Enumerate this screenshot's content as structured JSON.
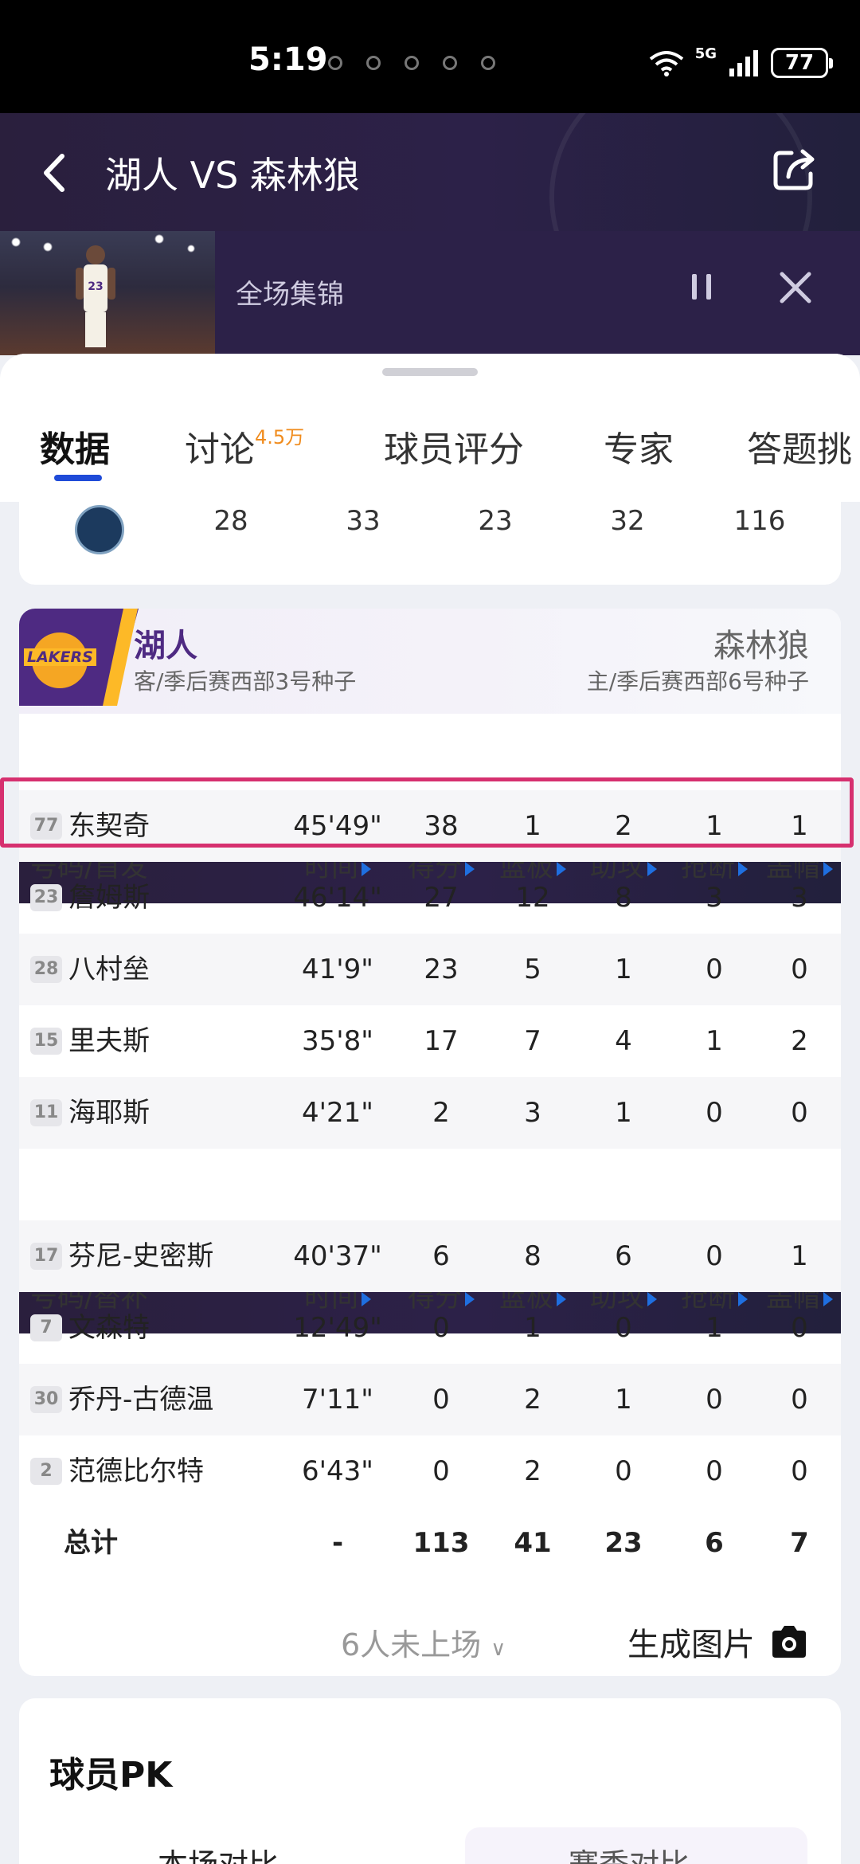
{
  "status_bar": {
    "time": "5:19",
    "network": "5G",
    "battery": "77"
  },
  "header": {
    "title": "湖人 VS 森林狼"
  },
  "video": {
    "title": "全场集锦"
  },
  "tabs": [
    {
      "label": "数据",
      "badge": ""
    },
    {
      "label": "讨论",
      "badge": "4.5万"
    },
    {
      "label": "球员评分",
      "badge": ""
    },
    {
      "label": "专家",
      "badge": ""
    },
    {
      "label": "答题挑",
      "badge": ""
    }
  ],
  "score_row": {
    "q1": "28",
    "q2": "33",
    "q3": "23",
    "q4": "32",
    "total": "116"
  },
  "teams": {
    "home": {
      "name": "湖人",
      "sub": "客/季后赛西部3号种子",
      "logo_text": "LAKERS"
    },
    "away": {
      "name": "森林狼",
      "sub": "主/季后赛西部6号种子"
    }
  },
  "columns": {
    "time": "时间",
    "pts": "得分",
    "reb": "篮板",
    "ast": "助攻",
    "stl": "抢断",
    "blk": "盖帽"
  },
  "starters_label": "号码/首发",
  "bench_label": "号码/替补",
  "starters": [
    {
      "num": "77",
      "name": "东契奇",
      "time": "45'49\"",
      "pts": "38",
      "reb": "1",
      "ast": "2",
      "stl": "1",
      "blk": "1"
    },
    {
      "num": "23",
      "name": "詹姆斯",
      "time": "46'14\"",
      "pts": "27",
      "reb": "12",
      "ast": "8",
      "stl": "3",
      "blk": "3"
    },
    {
      "num": "28",
      "name": "八村垒",
      "time": "41'9\"",
      "pts": "23",
      "reb": "5",
      "ast": "1",
      "stl": "0",
      "blk": "0"
    },
    {
      "num": "15",
      "name": "里夫斯",
      "time": "35'8\"",
      "pts": "17",
      "reb": "7",
      "ast": "4",
      "stl": "1",
      "blk": "2"
    },
    {
      "num": "11",
      "name": "海耶斯",
      "time": "4'21\"",
      "pts": "2",
      "reb": "3",
      "ast": "1",
      "stl": "0",
      "blk": "0"
    }
  ],
  "bench": [
    {
      "num": "17",
      "name": "芬尼-史密斯",
      "time": "40'37\"",
      "pts": "6",
      "reb": "8",
      "ast": "6",
      "stl": "0",
      "blk": "1"
    },
    {
      "num": "7",
      "name": "文森特",
      "time": "12'49\"",
      "pts": "0",
      "reb": "1",
      "ast": "0",
      "stl": "1",
      "blk": "0"
    },
    {
      "num": "30",
      "name": "乔丹-古德温",
      "time": "7'11\"",
      "pts": "0",
      "reb": "2",
      "ast": "1",
      "stl": "0",
      "blk": "0"
    },
    {
      "num": "2",
      "name": "范德比尔特",
      "time": "6'43\"",
      "pts": "0",
      "reb": "2",
      "ast": "0",
      "stl": "0",
      "blk": "0"
    }
  ],
  "totals": {
    "label": "总计",
    "time": "-",
    "pts": "113",
    "reb": "41",
    "ast": "23",
    "stl": "6",
    "blk": "7"
  },
  "footer": {
    "unplayed": "6人未上场",
    "generate": "生成图片"
  },
  "pk": {
    "title": "球员PK",
    "tab_current": "本场对比",
    "tab_season": "赛季对比"
  },
  "colors": {
    "accent": "#1f4bd8",
    "lakers_purple": "#4e2a82",
    "lakers_gold": "#fdb927",
    "highlight": "#d6306f",
    "badge_orange": "#f08c1e"
  }
}
